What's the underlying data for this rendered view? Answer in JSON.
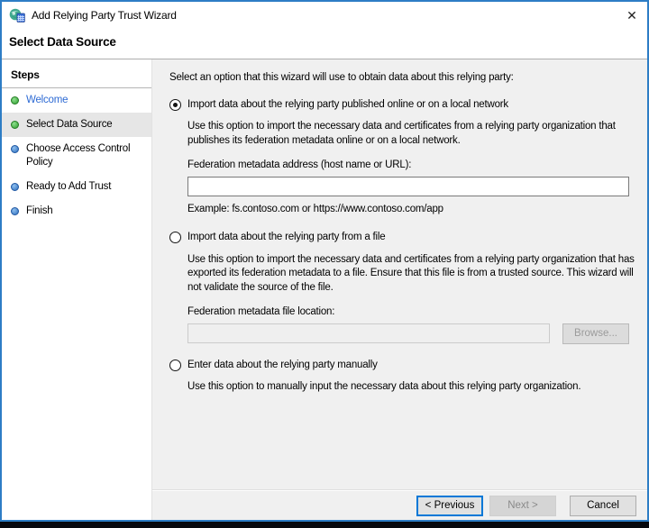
{
  "window": {
    "title": "Add Relying Party Trust Wizard",
    "close_icon": "✕"
  },
  "page": {
    "heading": "Select Data Source"
  },
  "sidebar": {
    "title": "Steps",
    "items": [
      {
        "label": "Welcome",
        "state": "done",
        "clickable": true
      },
      {
        "label": "Select Data Source",
        "state": "current",
        "clickable": false
      },
      {
        "label": "Choose Access Control Policy",
        "state": "upcoming",
        "clickable": false
      },
      {
        "label": "Ready to Add Trust",
        "state": "upcoming",
        "clickable": false
      },
      {
        "label": "Finish",
        "state": "upcoming",
        "clickable": false
      }
    ]
  },
  "main": {
    "intro": "Select an option that this wizard will use to obtain data about this relying party:",
    "options": [
      {
        "label": "Import data about the relying party published online or on a local network",
        "selected": true,
        "description": "Use this option to import the necessary data and certificates from a relying party organization that publishes its federation metadata online or on a local network.",
        "field_label": "Federation metadata address (host name or URL):",
        "field_value": "",
        "example": "Example: fs.contoso.com or https://www.contoso.com/app"
      },
      {
        "label": "Import data about the relying party from a file",
        "selected": false,
        "description": "Use this option to import the necessary data and certificates from a relying party organization that has exported its federation metadata to a file. Ensure that this file is from a trusted source.  This wizard will not validate the source of the file.",
        "field_label": "Federation metadata file location:",
        "field_value": "",
        "browse_label": "Browse...",
        "browse_enabled": false
      },
      {
        "label": "Enter data about the relying party manually",
        "selected": false,
        "description": "Use this option to manually input the necessary data about this relying party organization."
      }
    ]
  },
  "footer": {
    "previous_label": "< Previous",
    "next_label": "Next >",
    "next_enabled": false,
    "cancel_label": "Cancel"
  },
  "colors": {
    "window_border": "#2d7dc5",
    "focus_accent": "#0078d7",
    "step_done_bullet": "#2f9e2f",
    "step_todo_bullet": "#2f6fbe",
    "step_link_text": "#2e6bd4",
    "panel_bg": "#f0f0f0",
    "sidebar_bg": "#ffffff",
    "current_step_bg": "#e6e6e6"
  }
}
